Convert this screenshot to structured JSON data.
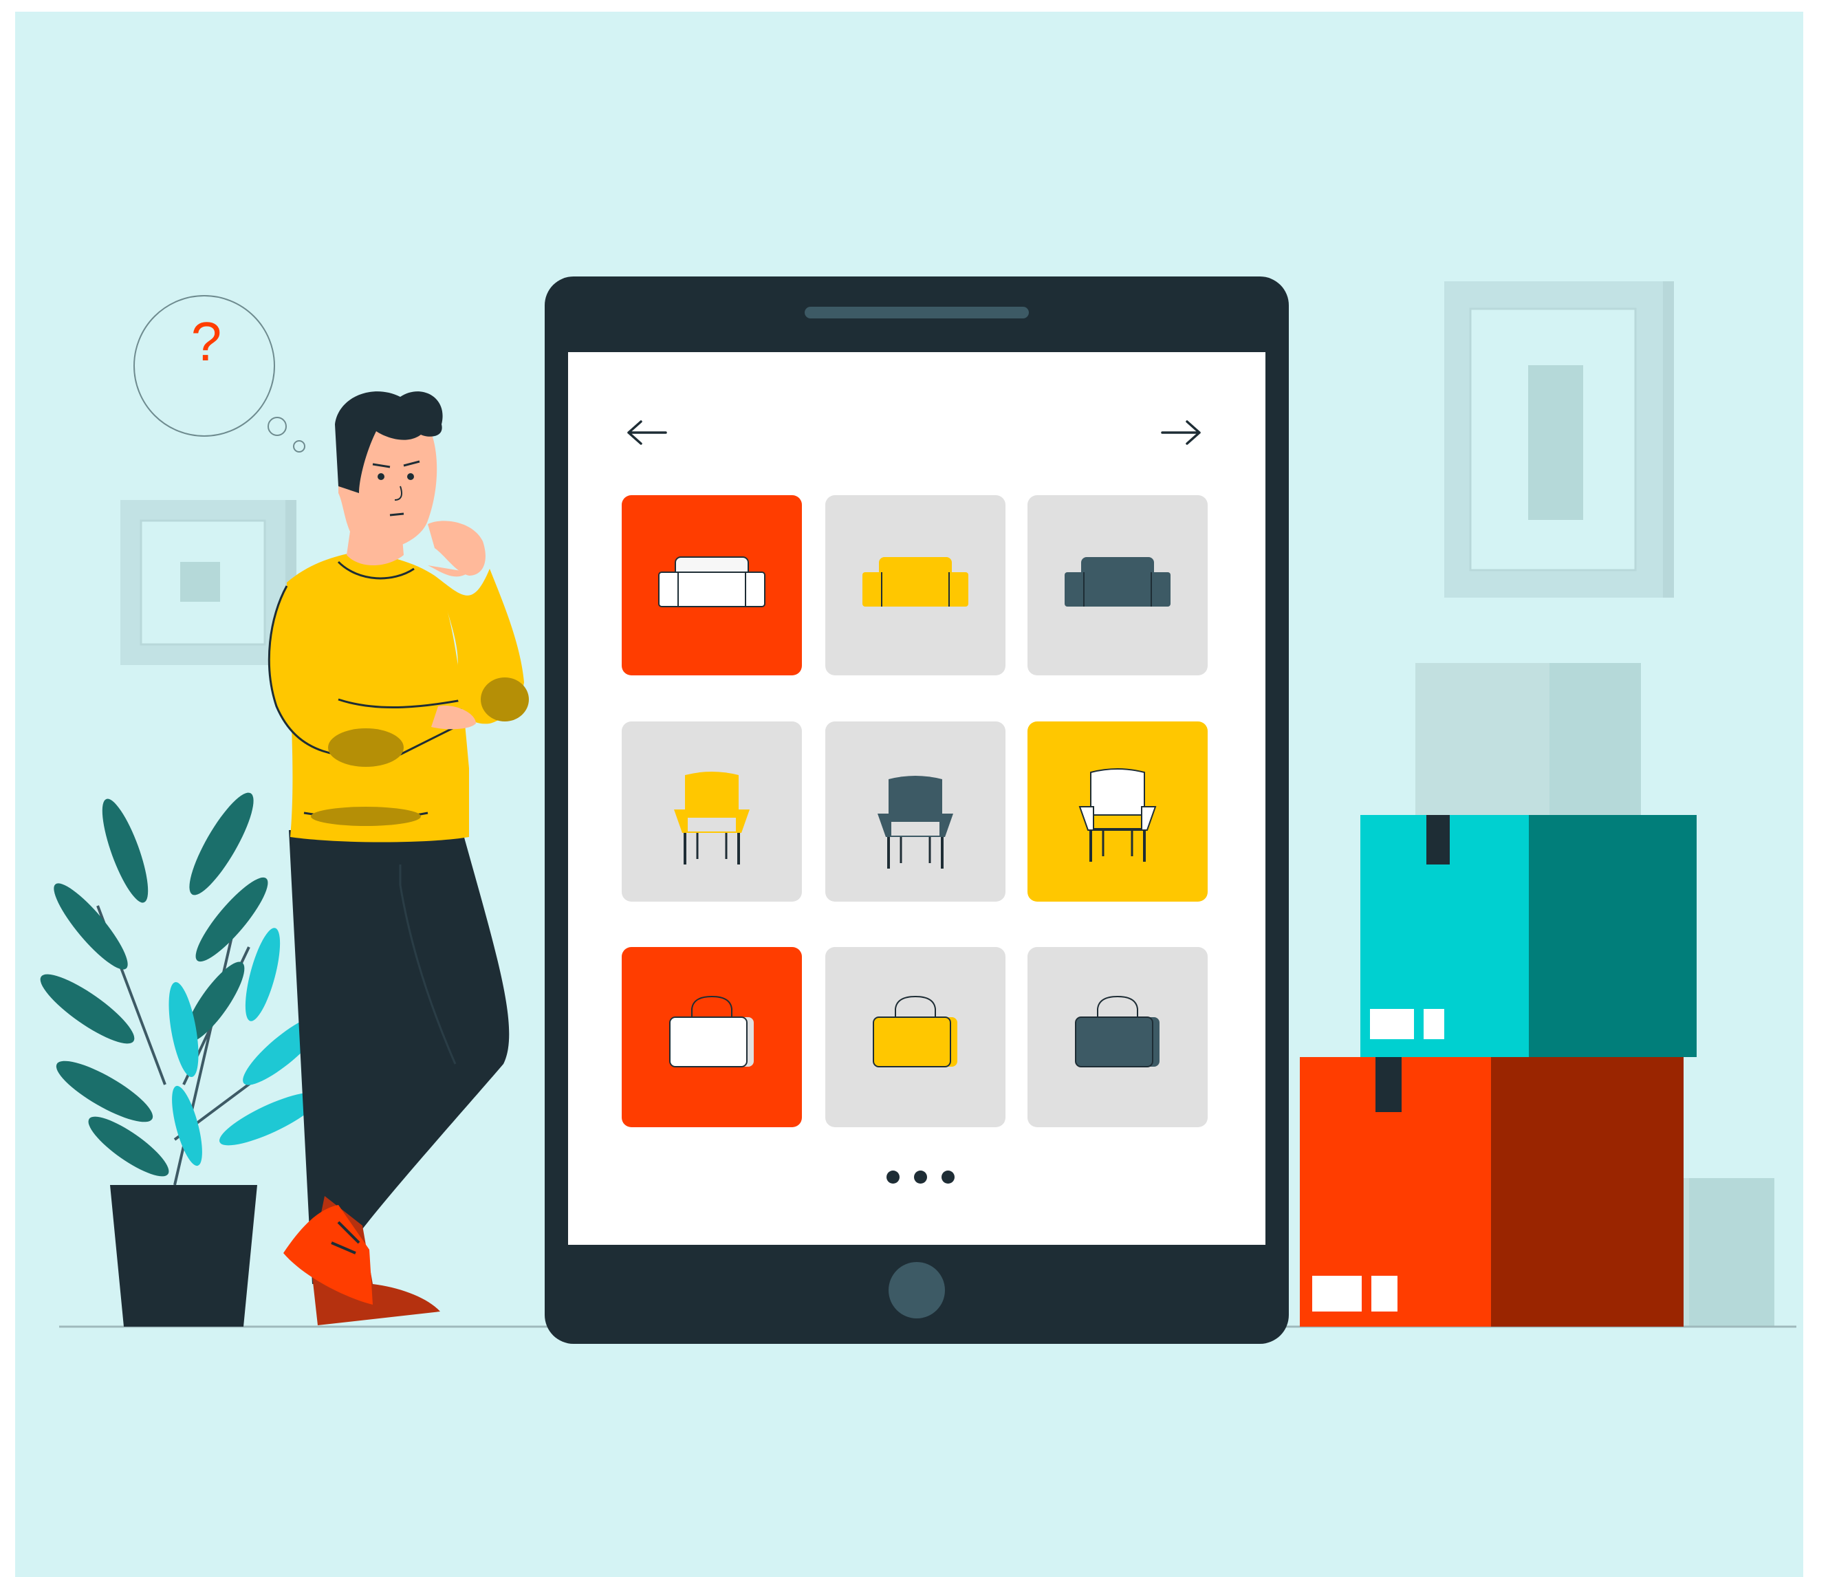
{
  "thought_bubble": {
    "symbol": "?"
  },
  "colors": {
    "background": "#d4f3f4",
    "tablet_body": "#1e2d35",
    "accent_red": "#ff3d00",
    "accent_yellow": "#ffc700",
    "tile_gray": "#e0e0e0",
    "teal": "#00d0d0"
  },
  "tablet": {
    "nav": {
      "prev_icon": "arrow-left-icon",
      "next_icon": "arrow-right-icon"
    },
    "grid": [
      {
        "item": "sofa",
        "color": "white",
        "background": "red"
      },
      {
        "item": "sofa",
        "color": "yellow",
        "background": "gray"
      },
      {
        "item": "sofa",
        "color": "dark",
        "background": "gray"
      },
      {
        "item": "armchair",
        "color": "yellow",
        "background": "gray"
      },
      {
        "item": "armchair",
        "color": "dark",
        "background": "gray"
      },
      {
        "item": "armchair",
        "color": "white",
        "background": "yellow"
      },
      {
        "item": "bag",
        "color": "white",
        "background": "red"
      },
      {
        "item": "bag",
        "color": "yellow",
        "background": "gray"
      },
      {
        "item": "bag",
        "color": "dark",
        "background": "gray"
      }
    ],
    "pagination": {
      "icon": "more-dots-icon",
      "count": 3
    }
  }
}
